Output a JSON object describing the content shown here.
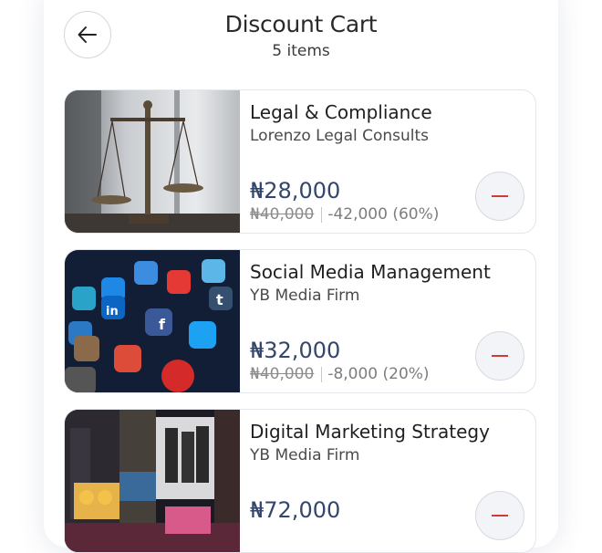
{
  "header": {
    "title": "Discount Cart",
    "subtitle": "5 items"
  },
  "items": [
    {
      "title": "Legal & Compliance",
      "seller": "Lorenzo Legal Consults",
      "price": "₦28,000",
      "old_price": "₦40,000",
      "discount": "-42,000 (60%)",
      "image": "scales-of-justice-photo"
    },
    {
      "title": "Social Media Management",
      "seller": "YB Media Firm",
      "price": "₦32,000",
      "old_price": "₦40,000",
      "discount": "-8,000 (20%)",
      "image": "social-media-apps-photo"
    },
    {
      "title": "Digital Marketing Strategy",
      "seller": "YB Media Firm",
      "price": "₦72,000",
      "image": "times-square-billboards-photo"
    }
  ],
  "colors": {
    "price": "#34466b",
    "remove_icon": "#d23a3a"
  }
}
